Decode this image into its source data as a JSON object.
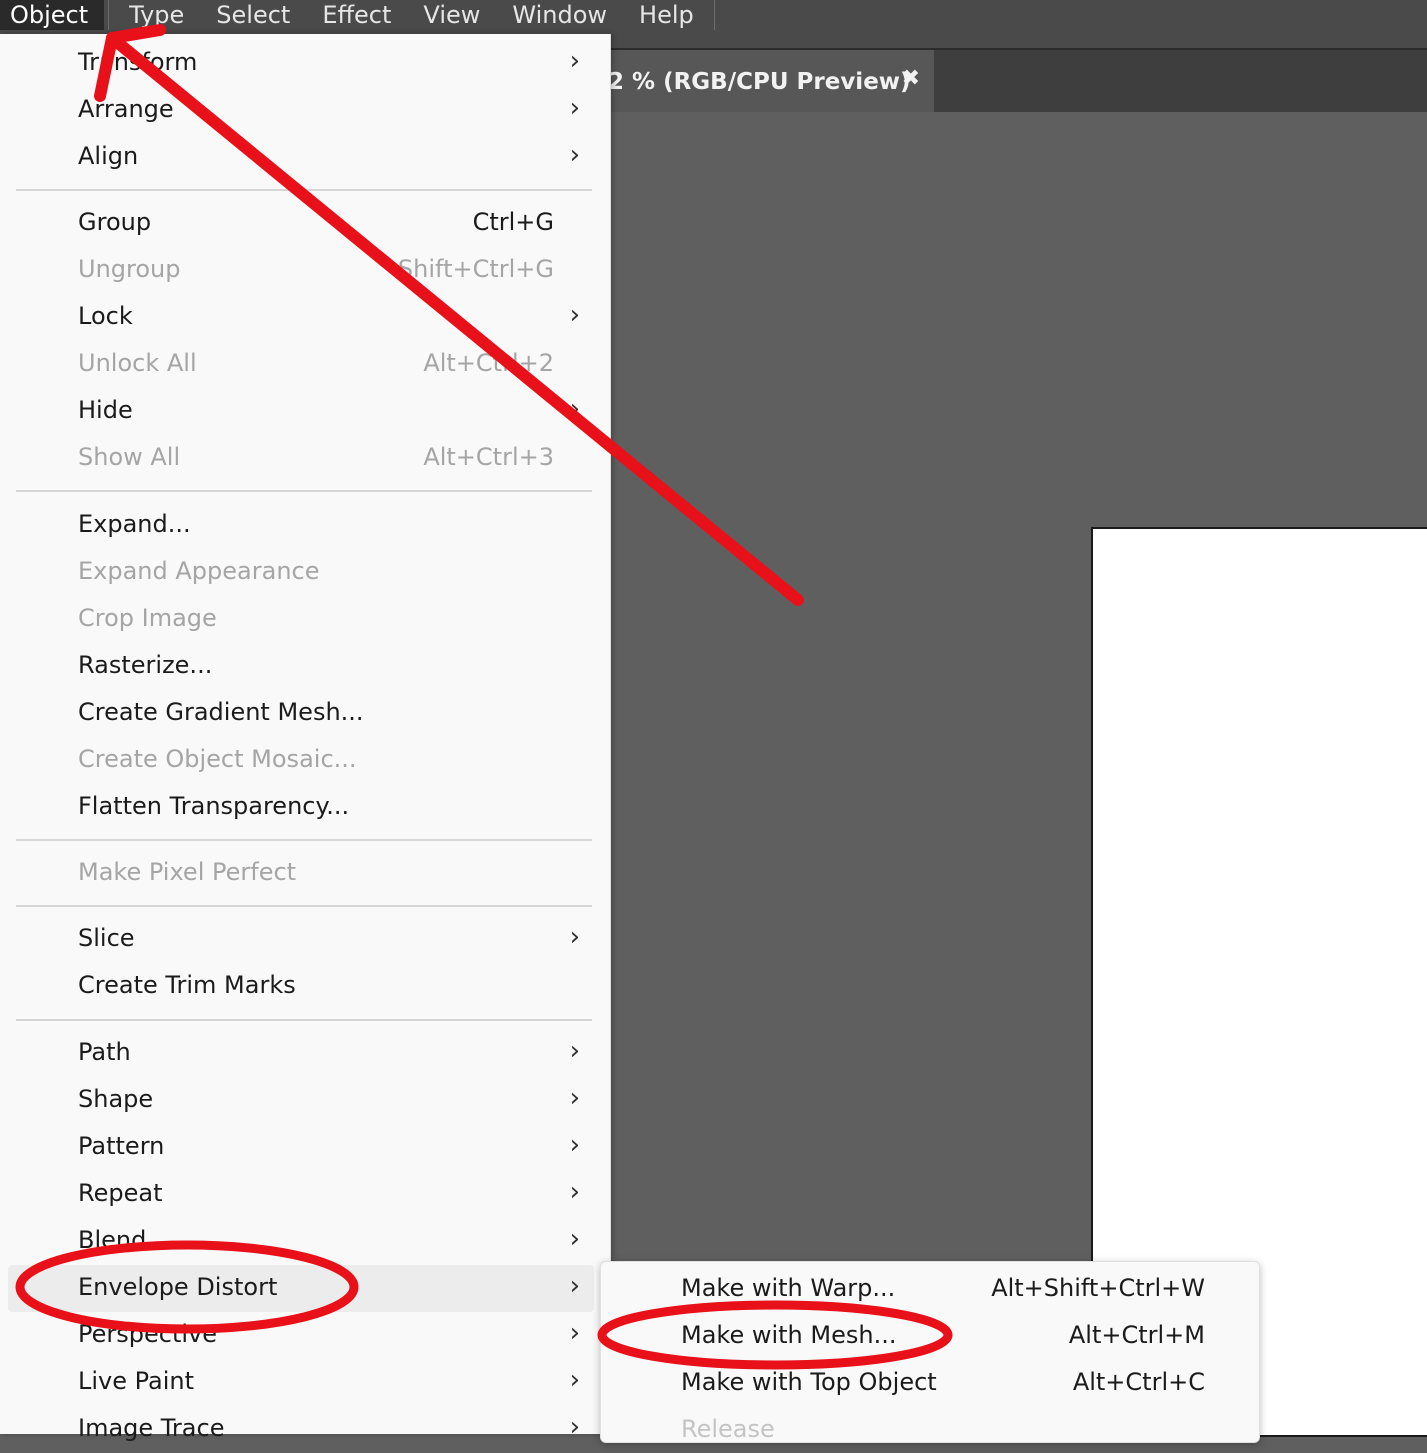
{
  "menubar": {
    "items": [
      "Object",
      "Type",
      "Select",
      "Effect",
      "View",
      "Window",
      "Help"
    ]
  },
  "document_tab": {
    "title": "2 % (RGB/CPU Preview)",
    "close_glyph": "✖"
  },
  "object_menu": {
    "items": [
      {
        "label": "Transform",
        "shortcut": "",
        "submenu": true,
        "disabled": false
      },
      {
        "label": "Arrange",
        "shortcut": "",
        "submenu": true,
        "disabled": false
      },
      {
        "label": "Align",
        "shortcut": "",
        "submenu": true,
        "disabled": false
      },
      {
        "label": "Group",
        "shortcut": "Ctrl+G",
        "submenu": false,
        "disabled": false
      },
      {
        "label": "Ungroup",
        "shortcut": "Shift+Ctrl+G",
        "submenu": false,
        "disabled": true
      },
      {
        "label": "Lock",
        "shortcut": "",
        "submenu": true,
        "disabled": false
      },
      {
        "label": "Unlock All",
        "shortcut": "Alt+Ctrl+2",
        "submenu": false,
        "disabled": true
      },
      {
        "label": "Hide",
        "shortcut": "",
        "submenu": true,
        "disabled": false
      },
      {
        "label": "Show All",
        "shortcut": "Alt+Ctrl+3",
        "submenu": false,
        "disabled": true
      },
      {
        "label": "Expand...",
        "shortcut": "",
        "submenu": false,
        "disabled": false
      },
      {
        "label": "Expand Appearance",
        "shortcut": "",
        "submenu": false,
        "disabled": true
      },
      {
        "label": "Crop Image",
        "shortcut": "",
        "submenu": false,
        "disabled": true
      },
      {
        "label": "Rasterize...",
        "shortcut": "",
        "submenu": false,
        "disabled": false
      },
      {
        "label": "Create Gradient Mesh...",
        "shortcut": "",
        "submenu": false,
        "disabled": false
      },
      {
        "label": "Create Object Mosaic...",
        "shortcut": "",
        "submenu": false,
        "disabled": true
      },
      {
        "label": "Flatten Transparency...",
        "shortcut": "",
        "submenu": false,
        "disabled": false
      },
      {
        "label": "Make Pixel Perfect",
        "shortcut": "",
        "submenu": false,
        "disabled": true
      },
      {
        "label": "Slice",
        "shortcut": "",
        "submenu": true,
        "disabled": false
      },
      {
        "label": "Create Trim Marks",
        "shortcut": "",
        "submenu": false,
        "disabled": false
      },
      {
        "label": "Path",
        "shortcut": "",
        "submenu": true,
        "disabled": false
      },
      {
        "label": "Shape",
        "shortcut": "",
        "submenu": true,
        "disabled": false
      },
      {
        "label": "Pattern",
        "shortcut": "",
        "submenu": true,
        "disabled": false
      },
      {
        "label": "Repeat",
        "shortcut": "",
        "submenu": true,
        "disabled": false
      },
      {
        "label": "Blend",
        "shortcut": "",
        "submenu": true,
        "disabled": false
      },
      {
        "label": "Envelope Distort",
        "shortcut": "",
        "submenu": true,
        "disabled": false,
        "highlighted": true
      },
      {
        "label": "Perspective",
        "shortcut": "",
        "submenu": true,
        "disabled": false
      },
      {
        "label": "Live Paint",
        "shortcut": "",
        "submenu": true,
        "disabled": false
      },
      {
        "label": "Image Trace",
        "shortcut": "",
        "submenu": true,
        "disabled": false
      }
    ]
  },
  "envelope_submenu": {
    "items": [
      {
        "label": "Make with Warp...",
        "shortcut": "Alt+Shift+Ctrl+W",
        "disabled": false
      },
      {
        "label": "Make with Mesh...",
        "shortcut": "Alt+Ctrl+M",
        "disabled": false
      },
      {
        "label": "Make with Top Object",
        "shortcut": "Alt+Ctrl+C",
        "disabled": false
      },
      {
        "label": "Release",
        "shortcut": "",
        "disabled": true
      }
    ]
  },
  "icons": {
    "chevron": "chevron-right-icon",
    "close": "close-icon"
  },
  "colors": {
    "annotation_red": "#e8111a",
    "menu_bg": "#f9f9f9",
    "menubar_bg": "#4a4a4a",
    "canvas_bg": "#5f5f5f"
  }
}
